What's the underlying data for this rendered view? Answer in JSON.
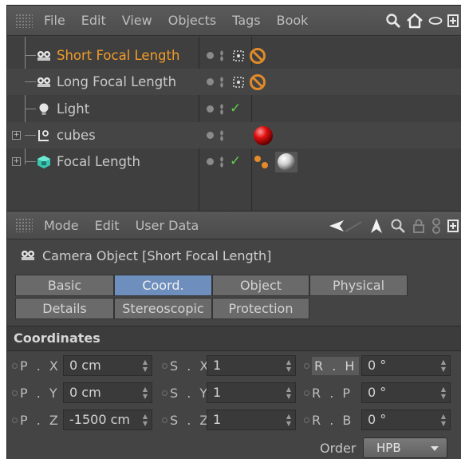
{
  "menubar": {
    "items": [
      "File",
      "Edit",
      "View",
      "Objects",
      "Tags",
      "Book"
    ],
    "tools": [
      "search-icon",
      "home-icon",
      "ellipse-icon",
      "new-window-icon"
    ]
  },
  "objects": [
    {
      "name": "Short Focal Length",
      "icon": "camera-icon",
      "active": true,
      "expander": false,
      "check": false,
      "tags": [
        "target-tag",
        "protection-tag"
      ]
    },
    {
      "name": "Long Focal Length",
      "icon": "camera-icon",
      "active": false,
      "expander": false,
      "check": false,
      "tags": [
        "target-tag",
        "protection-tag"
      ]
    },
    {
      "name": "Light",
      "icon": "light-bulb-icon",
      "active": false,
      "expander": false,
      "check": true,
      "tags": []
    },
    {
      "name": "cubes",
      "icon": "null-object-icon",
      "active": false,
      "expander": true,
      "check": false,
      "tags": [
        "material-red-tag"
      ]
    },
    {
      "name": "Focal Length",
      "icon": "cube-icon",
      "active": false,
      "expander": true,
      "check": true,
      "tags": [
        "phong-tag",
        "material-white-tag"
      ]
    }
  ],
  "attr_menubar": {
    "items": [
      "Mode",
      "Edit",
      "User Data"
    ],
    "tools": [
      "arrow-left-icon",
      "arrow-up-icon",
      "search-icon",
      "lock-icon",
      "chain-icon",
      "new-window-icon"
    ]
  },
  "attr_title": "Camera Object [Short Focal Length]",
  "tabs": {
    "row1": [
      "Basic",
      "Coord.",
      "Object",
      "Physical"
    ],
    "row2": [
      "Details",
      "Stereoscopic",
      "Protection"
    ],
    "active": "Coord."
  },
  "section_title": "Coordinates",
  "coords": [
    {
      "p_label": "P . X",
      "p_value": "0 cm",
      "s_label": "S . X",
      "s_value": "1",
      "r_label": "R . H",
      "r_value": "0 °"
    },
    {
      "p_label": "P . Y",
      "p_value": "0 cm",
      "s_label": "S . Y",
      "s_value": "1",
      "r_label": "R . P",
      "r_value": "0 °"
    },
    {
      "p_label": "P . Z",
      "p_value": "-1500 cm",
      "s_label": "S . Z",
      "s_value": "1",
      "r_label": "R . B",
      "r_value": "0 °"
    }
  ],
  "order": {
    "label": "Order",
    "value": "HPB"
  }
}
